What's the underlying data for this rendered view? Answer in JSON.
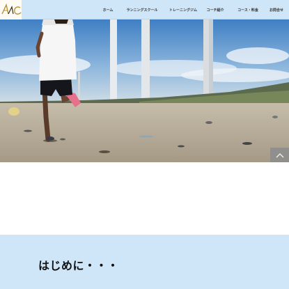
{
  "header": {
    "logo_text": "AAC",
    "nav_items": [
      {
        "label": "ホーム"
      },
      {
        "label": "ランニングスクール"
      },
      {
        "label": "トレーニングジム"
      },
      {
        "label": "コーチ紹介"
      },
      {
        "label": "コース・料金"
      },
      {
        "label": "お問合せ"
      }
    ]
  },
  "hero": {
    "image_icon": "runner-on-beach-photo"
  },
  "scroll_top": {
    "icon": "chevron-up-icon"
  },
  "intro": {
    "title": "はじめに・・・"
  },
  "colors": {
    "header_bg": "#cfe6f8",
    "intro_bg": "#cfe6f8",
    "logo_gold": "#b8902e",
    "logo_dark": "#3a2a1a",
    "to_top_bg": "#8d8d8d"
  }
}
